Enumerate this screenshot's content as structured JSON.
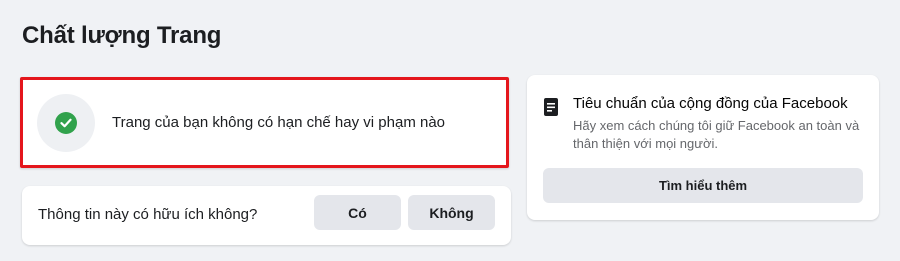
{
  "page": {
    "title": "Chất lượng Trang"
  },
  "status": {
    "message": "Trang của bạn không có hạn chế hay vi phạm nào",
    "icon": "check-circle-icon",
    "icon_color": "#31a24c",
    "highlight_color": "#e4161c"
  },
  "feedback": {
    "question": "Thông tin này có hữu ích không?",
    "yes_label": "Có",
    "no_label": "Không"
  },
  "standards": {
    "icon": "document-icon",
    "title": "Tiêu chuẩn của cộng đồng của Facebook",
    "description": "Hãy xem cách chúng tôi giữ Facebook an toàn và thân thiện với mọi người.",
    "button_label": "Tìm hiểu thêm"
  }
}
